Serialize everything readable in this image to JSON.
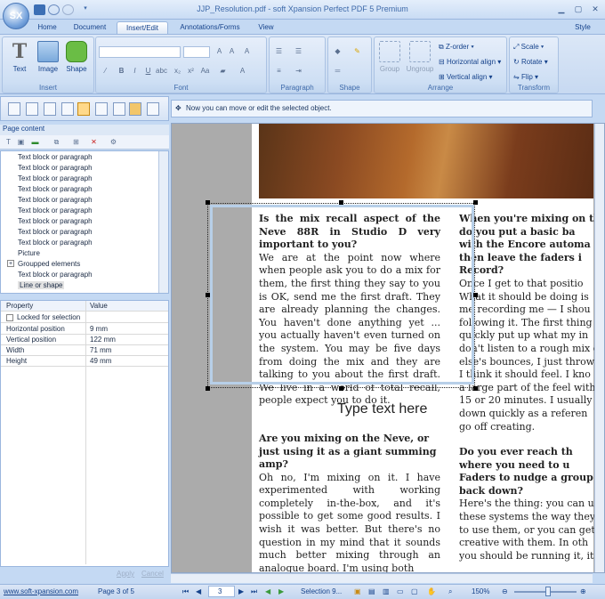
{
  "window": {
    "title": "JJP_Resolution.pdf - soft Xpansion Perfect PDF 5 Premium",
    "app_logo": "SX",
    "style_label": "Style"
  },
  "tabs": [
    "Home",
    "Document",
    "Insert/Edit",
    "Annotations/Forms",
    "View"
  ],
  "ribbon": {
    "insert": {
      "label": "Insert",
      "buttons": [
        "Text",
        "Image",
        "Shape"
      ]
    },
    "font": {
      "label": "Font"
    },
    "paragraph": {
      "label": "Paragraph"
    },
    "shape": {
      "label": "Shape"
    },
    "arrange": {
      "label": "Arrange",
      "buttons": [
        "Group",
        "Ungroup",
        "Z-order",
        "Horizontal align",
        "Vertical align"
      ]
    },
    "transform": {
      "label": "Transform",
      "buttons": [
        "Scale",
        "Rotate",
        "Flip"
      ]
    }
  },
  "infobar": {
    "message": "Now you can move or edit the selected object."
  },
  "panel": {
    "title": "Page content",
    "tree": [
      "Text block or paragraph",
      "Text block or paragraph",
      "Text block or paragraph",
      "Text block or paragraph",
      "Text block or paragraph",
      "Text block or paragraph",
      "Text block or paragraph",
      "Text block or paragraph",
      "Text block or paragraph",
      "Picture",
      "Groupped elements",
      "Text block or paragraph",
      "Line or shape"
    ]
  },
  "properties": {
    "headers": [
      "Property",
      "Value"
    ],
    "locked_label": "Locked for selection",
    "rows": [
      {
        "name": "Horizontal position",
        "value": "9 mm"
      },
      {
        "name": "Vertical position",
        "value": "122 mm"
      },
      {
        "name": "Width",
        "value": "71 mm"
      },
      {
        "name": "Height",
        "value": "49 mm"
      }
    ],
    "apply": "Apply",
    "cancel": "Cancel"
  },
  "document": {
    "left": {
      "h1": "Is the mix recall aspect of the Neve 88R in Studio D very important to you?",
      "p1": "We are at the point now where when people ask you to do a mix for them, the first thing they say to you is OK, send me the first draft. They are already planning the changes. You haven't done anything yet ... you actually haven't even turned on the system. You may be five days from doing the mix and they are talking to you about the first draft. We live in a world of total recall, people expect you to do it.",
      "h2": "Are you mixing on the Neve, or just using it as a giant summing amp?",
      "p2": "Oh no, I'm mixing on it. I have experimented with working completely in-the-box, and it's possible to get some good results. I wish it was better. But there's no question in my mind that it sounds much better mixing through an analogue board. I'm using both"
    },
    "right": {
      "lines": [
        "When you're mixing on th",
        "do you put a basic ba",
        "with the Encore automa",
        "then leave the faders i",
        "Record?",
        "Once I get to that positio",
        "What it should be doing is",
        "me recording me — I shou",
        "following it. The first thing",
        "quickly put up what my in",
        "don't listen to a rough mix o",
        "else's bounces, I just throw",
        "I think it should feel. I kno",
        "a large part of the feel withi",
        "15 or 20 minutes. I usually",
        "down quickly as a referen",
        "go off creating.",
        "",
        "Do you ever reach th",
        "where you need to u",
        "Faders to nudge a group",
        "back down?",
        "Here's the thing: you can u",
        "these systems the way they",
        "to use them, or you can get",
        "creative with them. In oth",
        "you should be running it, it"
      ]
    },
    "type_text": "Type text here"
  },
  "statusbar": {
    "website": "www.soft-xpansion.com",
    "page_info": "Page 3 of 5",
    "page_number": "3",
    "selection": "Selection 9...",
    "zoom": "150%"
  }
}
